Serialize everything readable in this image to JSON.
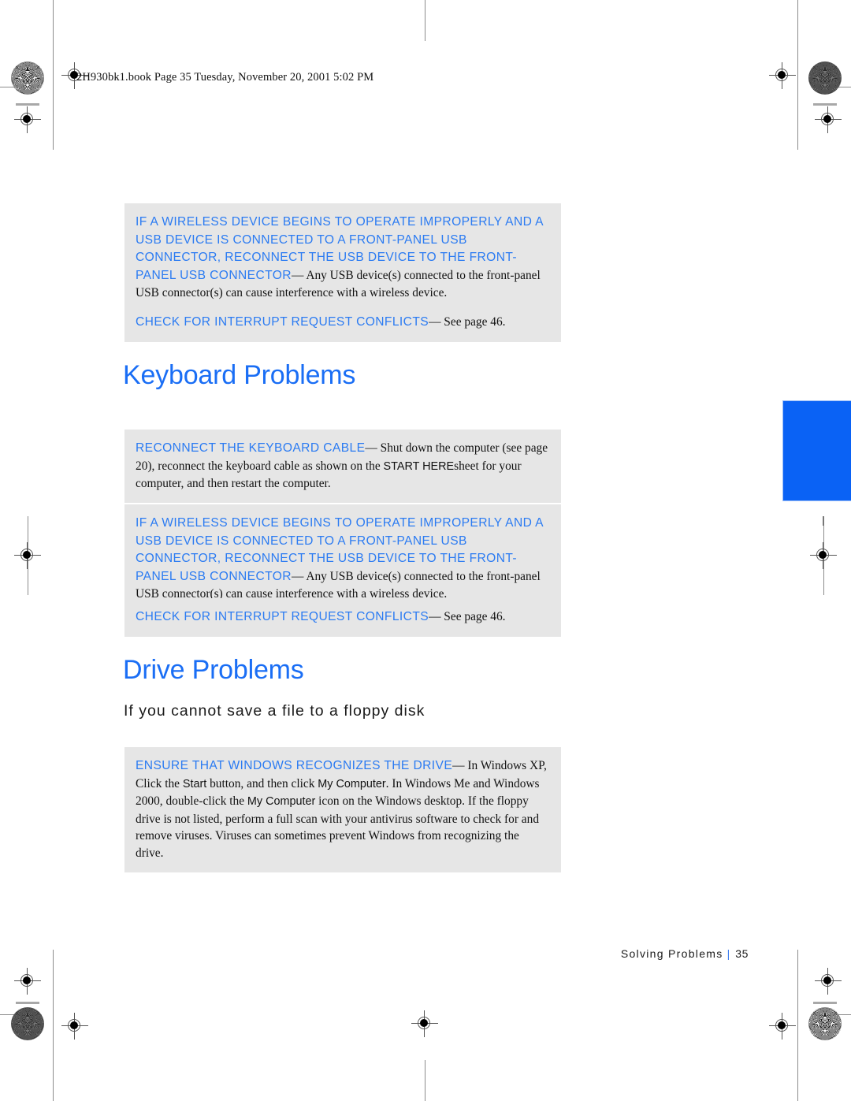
{
  "header": {
    "book_line": "2H930bk1.book  Page 35  Tuesday, November 20, 2001  5:02 PM"
  },
  "colors": {
    "heading_blue": "#1a6ef5",
    "lead_blue": "#2b7bf2",
    "tab_blue": "#0a62f5",
    "box_gray": "#e6e6e6",
    "body_black": "#121212"
  },
  "sections": [
    {
      "id": "wireless-usb-top",
      "boxes": [
        {
          "lead": "If a wireless device begins to operate improperly and a USB device is connected to a front-panel USB connector, reconnect the USB device to the front-panel USB connector",
          "dash": "—",
          "body": " Any USB device(s) connected to the front-panel USB connector(s) can cause interference with a wireless device."
        },
        {
          "lead": "Check for interrupt request conflicts",
          "dash": "—",
          "body": " See page 46."
        }
      ]
    },
    {
      "id": "keyboard-problems",
      "heading": "Keyboard Problems",
      "boxes": [
        {
          "lead": "Reconnect the keyboard cable",
          "dash": "—",
          "body_before": " Shut down the computer (see page 20), reconnect the keyboard cable as shown on the ",
          "ui_term": "START HERE",
          "body_after": "sheet for your computer, and then restart the computer."
        },
        {
          "lead": "If a wireless device begins to operate improperly and a USB device is connected to a front-panel USB connector, reconnect the USB device to the front-panel USB connector",
          "dash": "—",
          "body": " Any USB device(s) connected to the front-panel USB connector(s) can cause interference with a wireless device."
        },
        {
          "lead": "Check for interrupt request conflicts",
          "dash": "—",
          "body": " See page 46."
        }
      ]
    },
    {
      "id": "drive-problems",
      "heading": "Drive Problems",
      "subheading": "If you cannot save a file to a floppy disk",
      "boxes": [
        {
          "lead": "Ensure that Windows recognizes the drive",
          "dash": "—",
          "body_1": " In Windows XP, Click the ",
          "ui_1": "Start",
          "body_2": " button, and then click ",
          "ui_2": "My Computer",
          "body_3": ". In Windows Me and Windows 2000, double-click the ",
          "ui_3": "My Computer",
          "body_4": " icon on the Windows desktop. If the floppy drive is not listed, perform a full scan with your antivirus software to check for and remove viruses. Viruses can sometimes prevent Windows from recognizing the drive."
        }
      ]
    }
  ],
  "footer": {
    "chapter": "Solving Problems",
    "separator": "|",
    "page_number": "35"
  }
}
